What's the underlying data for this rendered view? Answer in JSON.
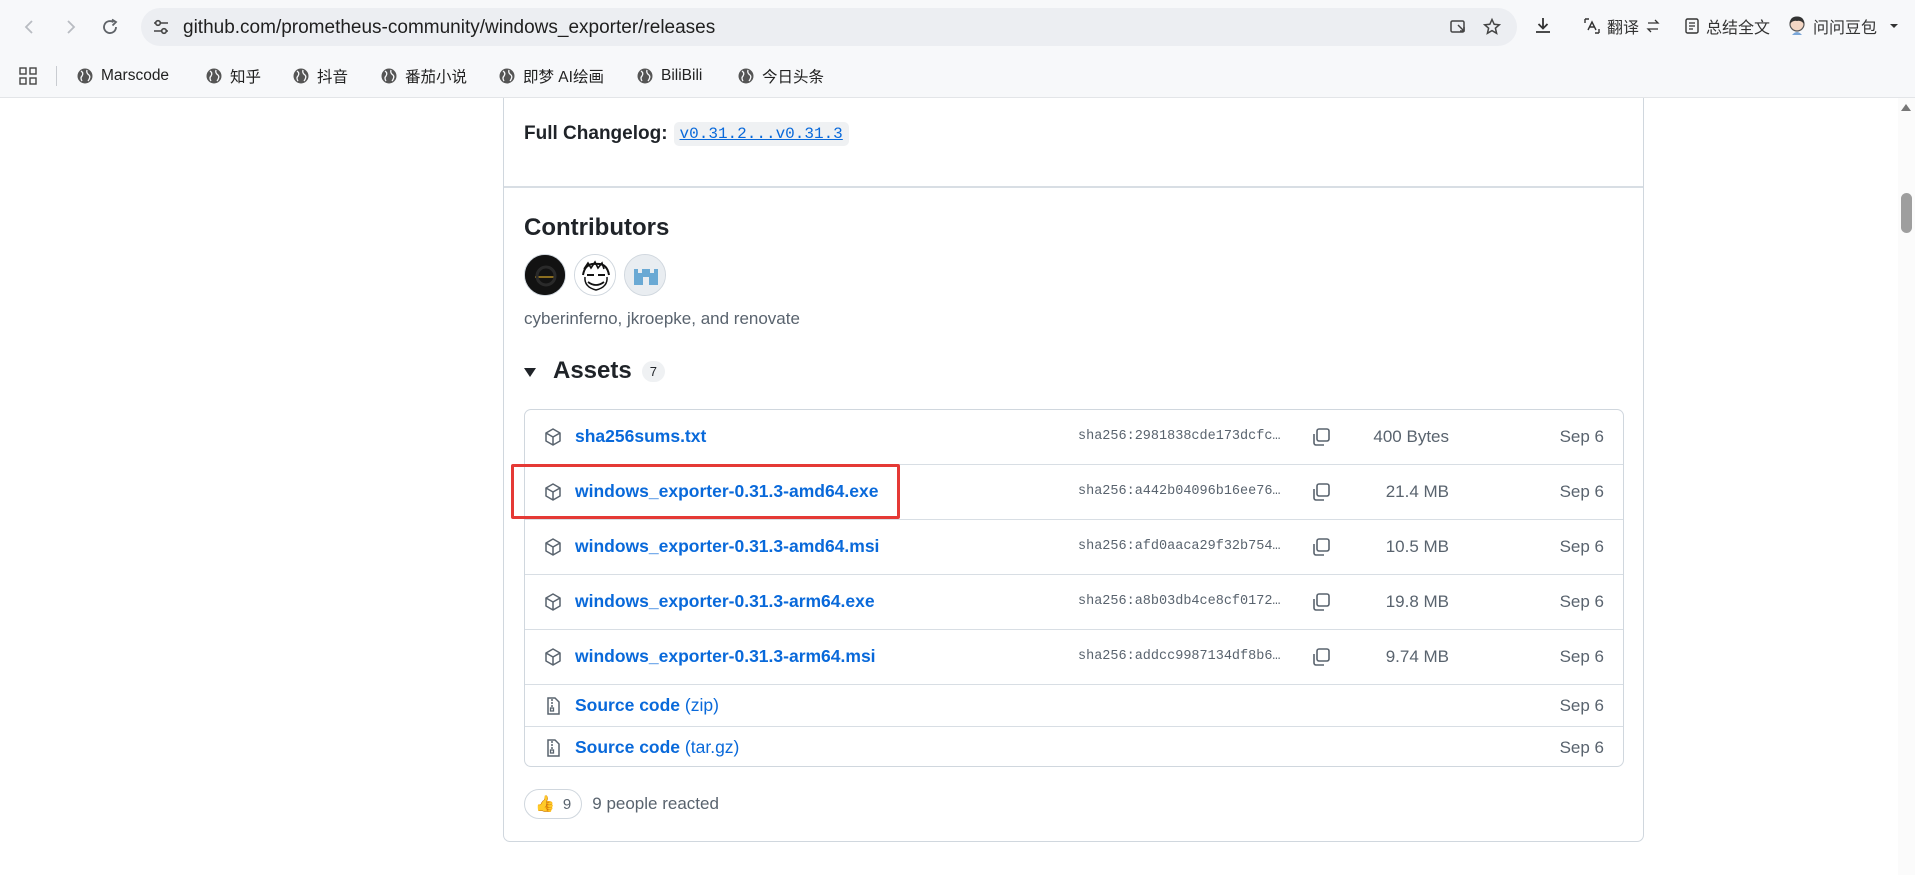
{
  "browser": {
    "url": "github.com/prometheus-community/windows_exporter/releases",
    "toolbar": {
      "translate_label": "翻译",
      "summary_label": "总结全文",
      "profile_label": "问问豆包"
    },
    "bookmarks": [
      {
        "label": "Marscode",
        "icon": "globe-icon"
      },
      {
        "label": "知乎",
        "icon": "globe-icon"
      },
      {
        "label": "抖音",
        "icon": "globe-icon"
      },
      {
        "label": "番茄小说",
        "icon": "globe-icon"
      },
      {
        "label": "即梦 AI绘画",
        "icon": "globe-icon"
      },
      {
        "label": "BiliBili",
        "icon": "globe-icon"
      },
      {
        "label": "今日头条",
        "icon": "globe-icon"
      }
    ]
  },
  "release": {
    "changelog_label": "Full Changelog:",
    "changelog_link": "v0.31.2...v0.31.3",
    "contributors_title": "Contributors",
    "contributors_names": "cyberinferno, jkroepke, and renovate",
    "assets_title": "Assets",
    "assets_count": "7",
    "assets": [
      {
        "name": "sha256sums.txt",
        "sha": "sha256:2981838cde173dcfc…",
        "size": "400 Bytes",
        "date": "Sep 6",
        "icon": "package-icon"
      },
      {
        "name": "windows_exporter-0.31.3-amd64.exe",
        "sha": "sha256:a442b04096b16ee76…",
        "size": "21.4 MB",
        "date": "Sep 6",
        "icon": "package-icon"
      },
      {
        "name": "windows_exporter-0.31.3-amd64.msi",
        "sha": "sha256:afd0aaca29f32b754…",
        "size": "10.5 MB",
        "date": "Sep 6",
        "icon": "package-icon"
      },
      {
        "name": "windows_exporter-0.31.3-arm64.exe",
        "sha": "sha256:a8b03db4ce8cf0172…",
        "size": "19.8 MB",
        "date": "Sep 6",
        "icon": "package-icon"
      },
      {
        "name": "windows_exporter-0.31.3-arm64.msi",
        "sha": "sha256:addcc9987134df8b6…",
        "size": "9.74 MB",
        "date": "Sep 6",
        "icon": "package-icon"
      }
    ],
    "source_assets": [
      {
        "name": "Source code",
        "suffix": "(zip)",
        "date": "Sep 6",
        "icon": "file-zip-icon"
      },
      {
        "name": "Source code",
        "suffix": "(tar.gz)",
        "date": "Sep 6",
        "icon": "file-zip-icon"
      }
    ],
    "reaction_emoji": "👍",
    "reaction_count": "9",
    "reaction_text": "9 people reacted"
  },
  "colors": {
    "link": "#0969da",
    "muted": "#59636e",
    "border": "#d0d7de",
    "highlight": "#e53935"
  }
}
